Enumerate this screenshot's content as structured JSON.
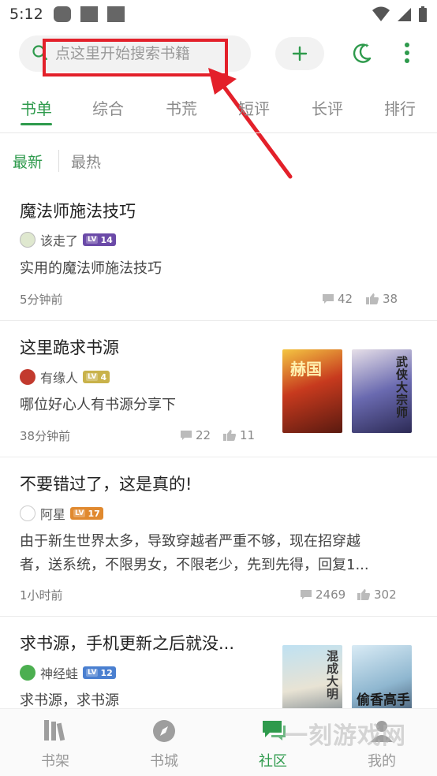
{
  "status_bar": {
    "time": "5:12"
  },
  "search": {
    "placeholder": "点这里开始搜索书籍"
  },
  "tabs": [
    {
      "label": "书单",
      "active": true
    },
    {
      "label": "综合"
    },
    {
      "label": "书荒"
    },
    {
      "label": "短评"
    },
    {
      "label": "长评"
    },
    {
      "label": "排行"
    }
  ],
  "sub_tabs": [
    {
      "label": "最新",
      "active": true
    },
    {
      "label": "最热"
    }
  ],
  "posts": [
    {
      "title": "魔法师施法技巧",
      "author": "该走了",
      "level": "14",
      "level_color": "#6b4aa8",
      "desc": "实用的魔法师施法技巧",
      "time": "5分钟前",
      "comments": "42",
      "likes": "38"
    },
    {
      "title": "这里跪求书源",
      "author": "有缘人",
      "level": "4",
      "level_color": "#c9b24a",
      "desc": "哪位好心人有书源分享下",
      "time": "38分钟前",
      "comments": "22",
      "likes": "11",
      "covers": [
        "赫国",
        "武侠大宗师"
      ]
    },
    {
      "title": "不要错过了，这是真的!",
      "author": "阿星",
      "level": "17",
      "level_color": "#e0892f",
      "desc_line1": "由于新生世界太多，导致穿越者严重不够，现在招穿越",
      "desc_line2": "者，送系统，不限男女，不限老少，先到先得，回复1...",
      "time": "1小时前",
      "comments": "2469",
      "likes": "302"
    },
    {
      "title": "求书源，手机更新之后就没...",
      "author": "神经蛙",
      "level": "12",
      "level_color": "#4a7fd0",
      "desc": "求书源，求书源",
      "covers": [
        "混成大明",
        "偷香高手"
      ]
    }
  ],
  "bottom_nav": [
    {
      "label": "书架",
      "icon": "bookshelf-icon"
    },
    {
      "label": "书城",
      "icon": "compass-icon"
    },
    {
      "label": "社区",
      "icon": "community-icon",
      "active": true
    },
    {
      "label": "我的",
      "icon": "profile-icon"
    }
  ],
  "watermark": "一刻游戏网",
  "colors": {
    "accent": "#2e9a4c",
    "highlight": "#e3202a"
  }
}
